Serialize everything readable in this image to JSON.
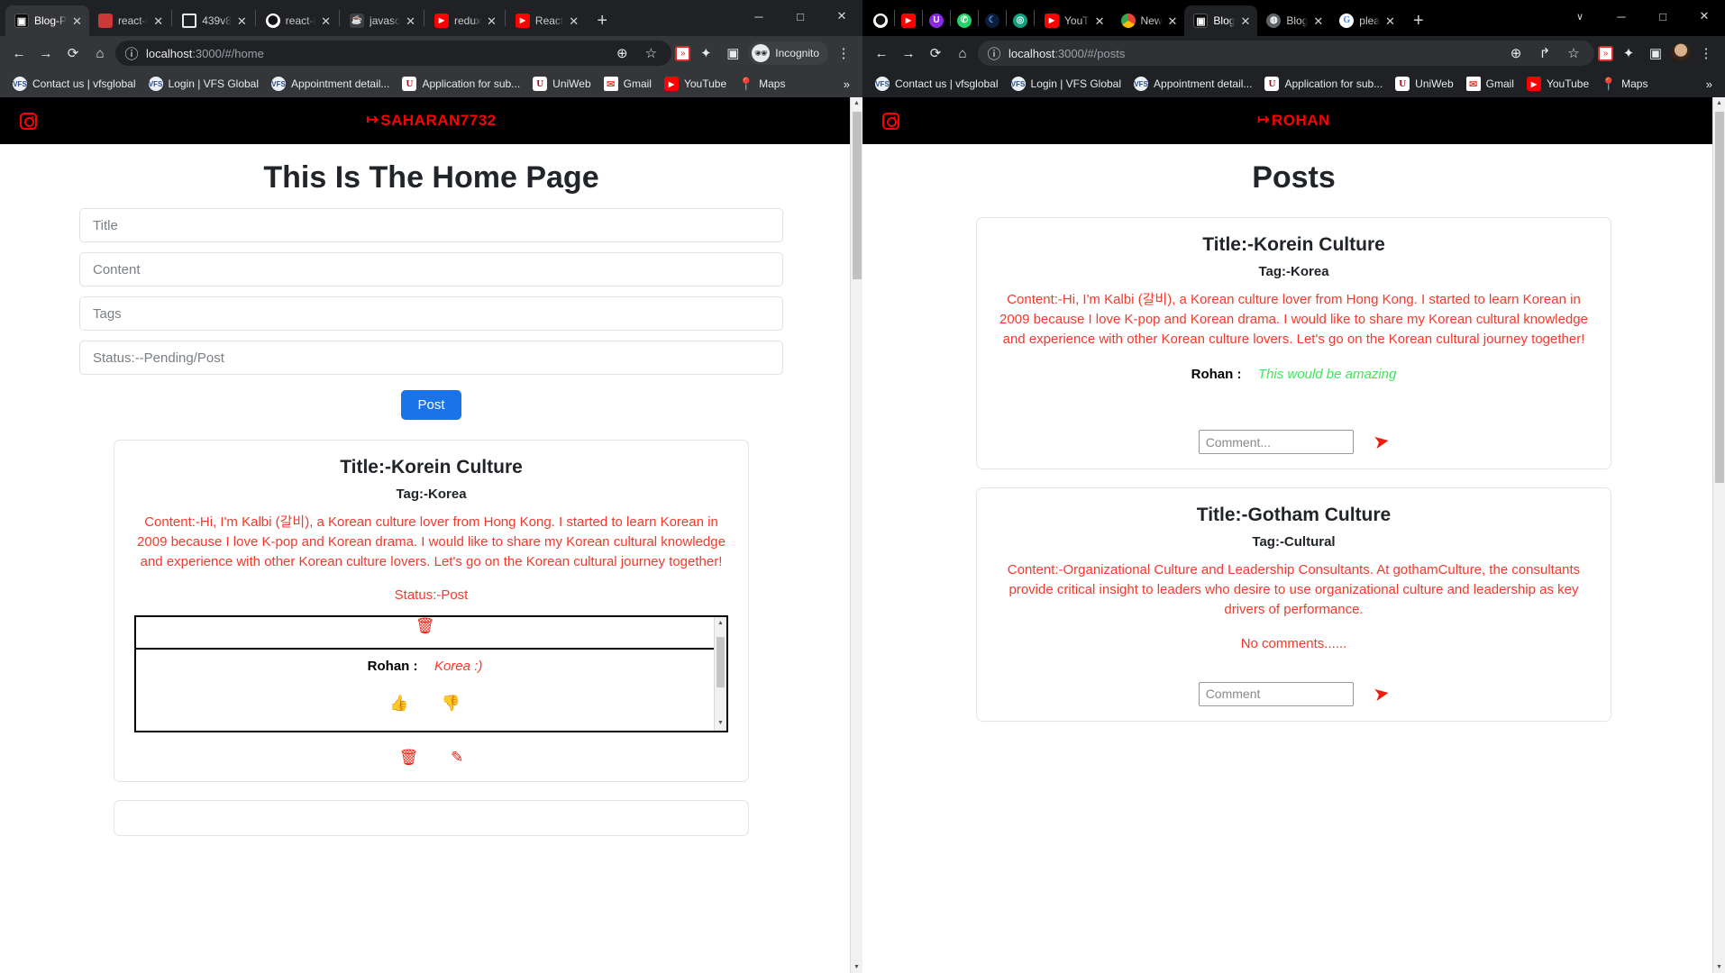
{
  "left_window": {
    "tabs": [
      {
        "title": "Blog-P",
        "favicon": "blog-icon",
        "active": true
      },
      {
        "title": "react-i",
        "favicon": "npm-icon",
        "active": false
      },
      {
        "title": "439v8",
        "favicon": "blank-page-icon",
        "active": false
      },
      {
        "title": "react-i",
        "favicon": "github-icon",
        "active": false
      },
      {
        "title": "javasc",
        "favicon": "java-icon",
        "active": false
      },
      {
        "title": "redux",
        "favicon": "youtube-icon",
        "active": false
      },
      {
        "title": "React",
        "favicon": "youtube-icon",
        "active": false
      }
    ],
    "new_tab_label": "+",
    "window_controls": {
      "minimize": "─",
      "maximize": "□",
      "close": "✕"
    },
    "toolbar": {
      "back": "←",
      "forward": "→",
      "reload": "⟳",
      "home": "⌂",
      "site_info_icon": "info-icon",
      "url_prefix": "localhost",
      "url_suffix": ":3000/#/home",
      "zoom_icon": "⊕",
      "bookmark_star": "☆",
      "extension_badge": "»",
      "extensions_icon": "✦",
      "sidepanel_icon": "▣",
      "profile_label": "Incognito",
      "menu_icon": "⋮"
    },
    "bookmarks": [
      {
        "label": "Contact us | vfsglobal",
        "icon": "vfs-icon"
      },
      {
        "label": "Login | VFS Global",
        "icon": "vfs-icon"
      },
      {
        "label": "Appointment detail...",
        "icon": "vfs-icon"
      },
      {
        "label": "Application for sub...",
        "icon": "u-icon"
      },
      {
        "label": "UniWeb",
        "icon": "u-icon"
      },
      {
        "label": "Gmail",
        "icon": "gmail-icon"
      },
      {
        "label": "YouTube",
        "icon": "youtube-icon"
      },
      {
        "label": "Maps",
        "icon": "maps-icon"
      }
    ],
    "bookmarks_overflow": "»",
    "page": {
      "brand": "SAHARAN7732",
      "brand_logout_glyph": "↦",
      "instagram_icon": "instagram-icon",
      "title": "This Is The Home Page",
      "form": {
        "title_placeholder": "Title",
        "title_value": "",
        "content_placeholder": "Content",
        "content_value": "",
        "tags_placeholder": "Tags",
        "tags_value": "",
        "status_placeholder": "Status:--Pending/Post",
        "status_value": "",
        "post_button": "Post"
      },
      "post": {
        "title": "Title:-Korein Culture",
        "tag": "Tag:-Korea",
        "content": "Content:-Hi, I'm Kalbi (갈비), a Korean culture lover from Hong Kong. I started to learn Korean in 2009 because I love K-pop and Korean drama. I would like to share my Korean cultural knowledge and experience with other Korean culture lovers. Let's go on the Korean cultural journey together!",
        "status": "Status:-Post",
        "comment_author": "Rohan :",
        "comment_text": "Korea :)",
        "delete_icon": "trash-icon",
        "edit_icon": "edit-pencil-icon",
        "like_icon": "thumbs-up-icon",
        "dislike_icon": "thumbs-down-icon"
      }
    }
  },
  "right_window": {
    "tabs": [
      {
        "title": "",
        "favicon": "github-icon",
        "active": false
      },
      {
        "title": "",
        "favicon": "youtube-icon",
        "active": false
      },
      {
        "title": "",
        "favicon": "purple-icon",
        "active": false
      },
      {
        "title": "",
        "favicon": "whatsapp-icon",
        "active": false
      },
      {
        "title": "",
        "favicon": "moon-icon",
        "active": false
      },
      {
        "title": "",
        "favicon": "chatgpt-icon",
        "active": false
      },
      {
        "title": "YouT",
        "favicon": "youtube-icon",
        "active": false
      },
      {
        "title": "New",
        "favicon": "chrome-icon",
        "active": false
      },
      {
        "title": "Blog",
        "favicon": "blog-icon",
        "active": true
      },
      {
        "title": "Blog",
        "favicon": "gray-icon",
        "active": false
      },
      {
        "title": "plea",
        "favicon": "google-icon",
        "active": false
      }
    ],
    "new_tab_label": "+",
    "window_controls": {
      "chevron": "∨",
      "minimize": "─",
      "maximize": "□",
      "close": "✕"
    },
    "toolbar": {
      "back": "←",
      "forward": "→",
      "reload": "⟳",
      "home": "⌂",
      "site_info_icon": "info-icon",
      "url_prefix": "localhost",
      "url_suffix": ":3000/#/posts",
      "zoom_icon": "⊕",
      "share_icon": "↱",
      "bookmark_star": "☆",
      "extension_badge": "»",
      "extensions_icon": "✦",
      "sidepanel_icon": "▣",
      "menu_icon": "⋮"
    },
    "bookmarks": [
      {
        "label": "Contact us | vfsglobal",
        "icon": "vfs-icon"
      },
      {
        "label": "Login | VFS Global",
        "icon": "vfs-icon"
      },
      {
        "label": "Appointment detail...",
        "icon": "vfs-icon"
      },
      {
        "label": "Application for sub...",
        "icon": "u-icon"
      },
      {
        "label": "UniWeb",
        "icon": "u-icon"
      },
      {
        "label": "Gmail",
        "icon": "gmail-icon"
      },
      {
        "label": "YouTube",
        "icon": "youtube-icon"
      },
      {
        "label": "Maps",
        "icon": "maps-icon"
      }
    ],
    "bookmarks_overflow": "»",
    "page": {
      "brand": "ROHAN",
      "brand_logout_glyph": "↦",
      "instagram_icon": "instagram-icon",
      "title": "Posts",
      "posts": [
        {
          "title": "Title:-Korein Culture",
          "tag": "Tag:-Korea",
          "content": "Content:-Hi, I'm Kalbi (갈비), a Korean culture lover from Hong Kong. I started to learn Korean in 2009 because I love K-pop and Korean drama. I would like to share my Korean cultural knowledge and experience with other Korean culture lovers. Let's go on the Korean cultural journey together!",
          "comment_author": "Rohan :",
          "comment_text": "This would be amazing",
          "no_comments": "",
          "comment_placeholder": "Comment...",
          "comment_value": "",
          "send_icon": "send-plane-icon"
        },
        {
          "title": "Title:-Gotham Culture",
          "tag": "Tag:-Cultural",
          "content": "Content:-Organizational Culture and Leadership Consultants. At gothamCulture, the consultants provide critical insight to leaders who desire to use organizational culture and leadership as key drivers of performance.",
          "comment_author": "",
          "comment_text": "",
          "no_comments": "No comments......",
          "comment_placeholder": "Comment",
          "comment_value": "",
          "send_icon": "send-plane-icon"
        }
      ]
    }
  },
  "colors": {
    "accent_red": "#ff0000",
    "content_red": "#f5382b",
    "comment_green": "#3ce85a",
    "post_button_blue": "#1a73e8",
    "thumb_up_green": "#0b8c1a",
    "nav_black": "#000000"
  }
}
